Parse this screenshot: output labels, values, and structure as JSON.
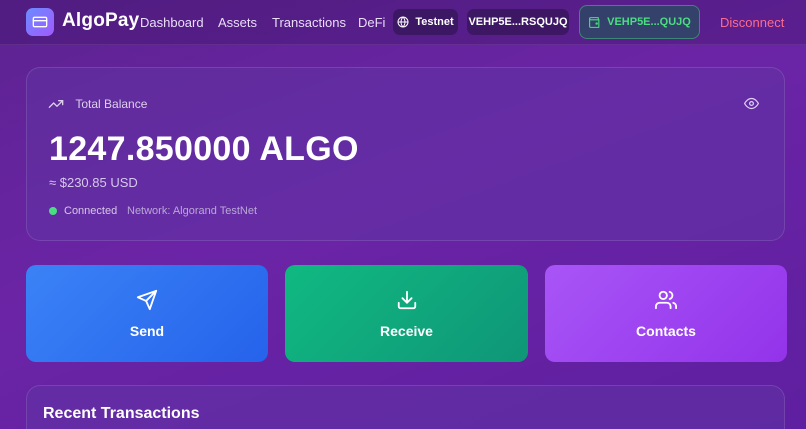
{
  "header": {
    "brand": "AlgoPay",
    "nav": [
      "Dashboard",
      "Assets",
      "Transactions",
      "DeFi"
    ],
    "network_badge": "Testnet",
    "address_short": "VEHP5E...RSQUJQ",
    "wallet_short": "VEHP5E...QUJQ",
    "disconnect_label": "Disconnect"
  },
  "balance": {
    "label": "Total Balance",
    "amount": "1247.850000 ALGO",
    "usd": "≈ $230.85 USD",
    "status": "Connected",
    "network": "Network: Algorand TestNet"
  },
  "actions": {
    "send": "Send",
    "receive": "Receive",
    "contacts": "Contacts"
  },
  "recent": {
    "title": "Recent Transactions"
  },
  "colors": {
    "send": "#3b82f6",
    "receive": "#10b981",
    "contacts": "#a855f7",
    "connected": "#4ade80",
    "disconnect": "#ff6b8a"
  }
}
